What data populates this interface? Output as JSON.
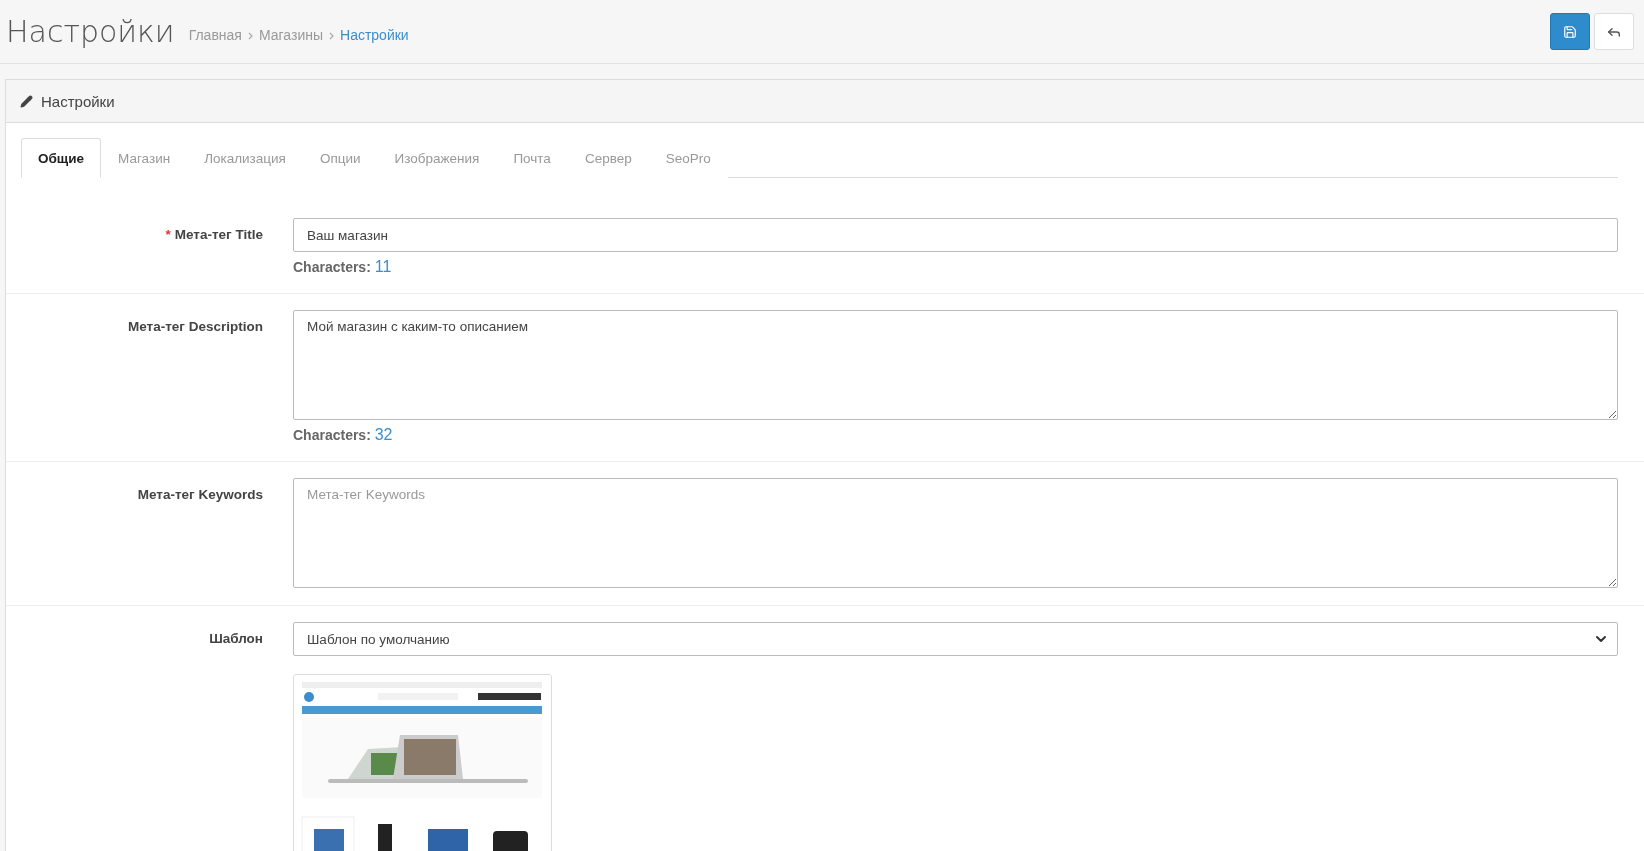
{
  "header": {
    "title": "Настройки",
    "breadcrumbs": [
      {
        "label": "Главная",
        "selected": false
      },
      {
        "label": "Магазины",
        "selected": false
      },
      {
        "label": "Настройки",
        "selected": true
      }
    ],
    "buttons": [
      {
        "kind": "save"
      },
      {
        "kind": "back"
      }
    ]
  },
  "panel": {
    "title": "Настройки",
    "tabs": [
      {
        "label": "Общие",
        "selected": true
      },
      {
        "label": "Магазин",
        "selected": false
      },
      {
        "label": "Локализация",
        "selected": false
      },
      {
        "label": "Опции",
        "selected": false
      },
      {
        "label": "Изображения",
        "selected": false
      },
      {
        "label": "Почта",
        "selected": false
      },
      {
        "label": "Сервер",
        "selected": false
      },
      {
        "label": "SeoPro",
        "selected": false
      }
    ],
    "fields": [
      {
        "kind": "input",
        "required_mark": "*",
        "label": "Мета-тег Title",
        "value": "Ваш магазин",
        "counter_label": "Characters:",
        "counter": "11"
      },
      {
        "kind": "textarea",
        "label": "Мета-тег Description",
        "value": "Мой магазин с каким-то описанием",
        "counter_label": "Characters:",
        "counter": "32"
      },
      {
        "kind": "textarea",
        "label": "Мета-тег Keywords",
        "placeholder": "Мета-тег Keywords"
      },
      {
        "kind": "select",
        "label": "Шаблон",
        "value": "Шаблон по умолчанию"
      }
    ]
  }
}
